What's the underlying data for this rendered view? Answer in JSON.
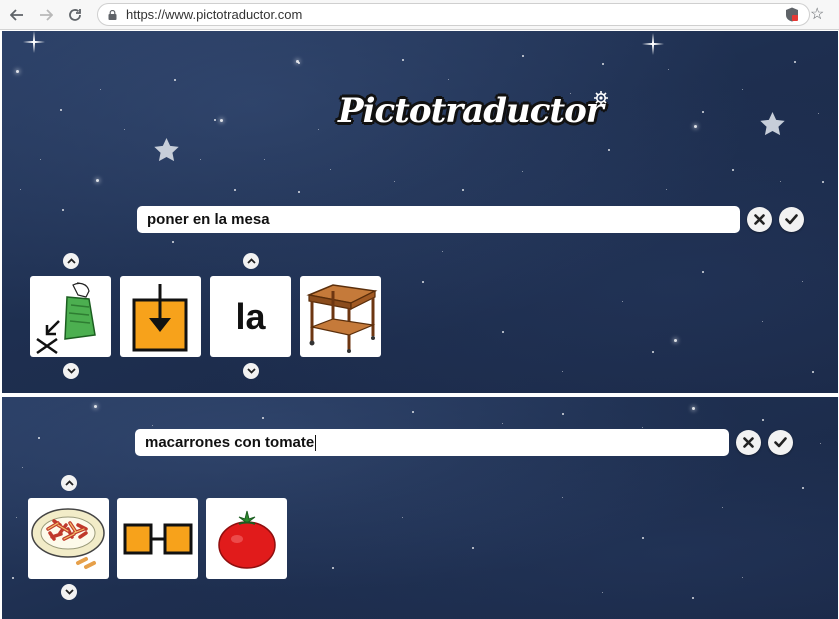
{
  "browser": {
    "url": "https://www.pictotraductor.com",
    "icons": [
      "back-arrow-icon",
      "forward-arrow-icon",
      "reload-icon",
      "lock-icon",
      "extension-icon",
      "bookmark-star-icon"
    ]
  },
  "app": {
    "logo_text": "Pictotraductor"
  },
  "panel1": {
    "input_value": "poner en la mesa",
    "clear_icon": "close-icon",
    "confirm_icon": "check-icon",
    "pictograms": [
      {
        "icon": "put-hand-bag-icon"
      },
      {
        "icon": "down-into-box-icon"
      },
      {
        "label": "la"
      },
      {
        "icon": "table-icon"
      }
    ]
  },
  "panel2": {
    "input_value": "macarrones con tomate",
    "clear_icon": "close-icon",
    "confirm_icon": "check-icon",
    "pictograms": [
      {
        "icon": "macaroni-plate-icon"
      },
      {
        "icon": "linked-boxes-icon"
      },
      {
        "icon": "tomato-icon"
      }
    ]
  },
  "colors": {
    "background": "#1e2f50",
    "pictogram_orange": "#f7a21b",
    "tomato_red": "#e11b1b"
  }
}
